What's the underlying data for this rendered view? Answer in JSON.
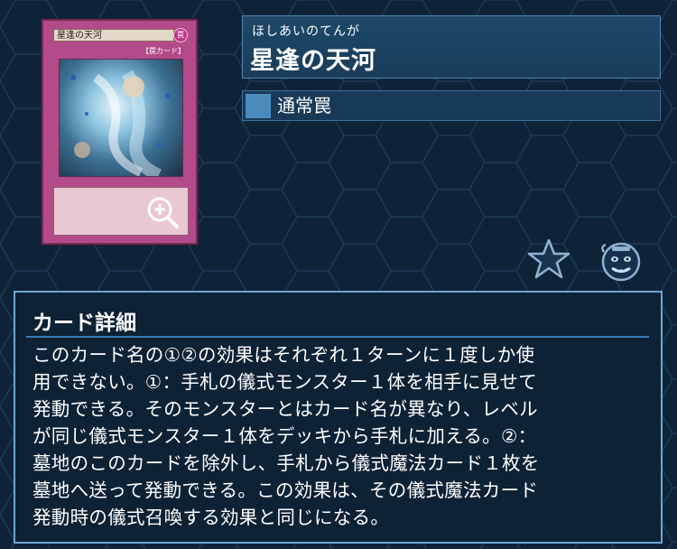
{
  "card": {
    "ruby": "ほしあいのてんが",
    "name": "星逢の天河",
    "type": "通常罠",
    "thumb_title": "星逢の天河",
    "thumb_attribute": "罠",
    "thumb_type": "【罠カード】"
  },
  "icons": {
    "zoom": "zoom-in-icon",
    "favorite": "star-icon",
    "mascot": "pot-of-greed-icon"
  },
  "details": {
    "heading": "カード詳細",
    "text": "このカード名の①②の効果はそれぞれ１ターンに１度しか使\n用できない。①：手札の儀式モンスター１体を相手に見せて\n発動できる。そのモンスターとはカード名が異なり、レベル\nが同じ儀式モンスター１体をデッキから手札に加える。②：\n墓地のこのカードを除外し、手札から儀式魔法カード１枚を\n墓地へ送って発動できる。この効果は、その儀式魔法カード\n発動時の儀式召喚する効果と同じになる。"
  },
  "colors": {
    "background": "#0f2338",
    "panel": "#1e4868",
    "accent": "#4a8bbb",
    "card_frame": "#b34a8a"
  }
}
